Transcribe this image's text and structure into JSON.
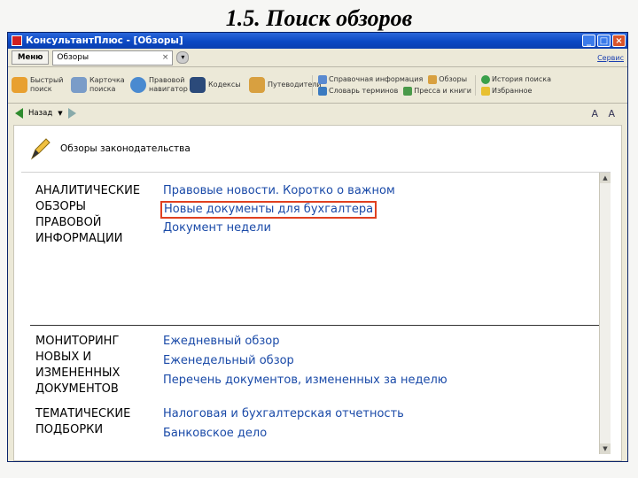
{
  "slide_title": "1.5. Поиск обзоров",
  "window": {
    "title": "КонсультантПлюс - [Обзоры]",
    "buttons": [
      "_",
      "□",
      "×"
    ]
  },
  "tabrow": {
    "menu_label": "Меню",
    "tab_label": "Обзоры",
    "right_link": "Сервис"
  },
  "toolbar": {
    "items": [
      {
        "label": "Быстрый поиск",
        "icon": "quick-search-icon"
      },
      {
        "label": "Карточка поиска",
        "icon": "search-card-icon"
      },
      {
        "label": "Правовой навигатор",
        "icon": "navigator-icon"
      },
      {
        "label": "Кодексы",
        "icon": "codes-icon"
      },
      {
        "label": "Путеводители",
        "icon": "guides-icon"
      }
    ],
    "group1": [
      "Справочная информация",
      "Обзоры",
      "Словарь терминов",
      "Пресса и книги"
    ],
    "group2": [
      "История поиска",
      "Избранное"
    ]
  },
  "navbar": {
    "back_label": "Назад",
    "font_control": "A A"
  },
  "content": {
    "header_title": "Обзоры законодательства",
    "sections": [
      {
        "title_lines": [
          "АНАЛИТИЧЕСКИЕ",
          "ОБЗОРЫ",
          "ПРАВОВОЙ",
          "ИНФОРМАЦИИ"
        ],
        "links": [
          "Правовые новости. Коротко о важном",
          "Новые документы для бухгалтера",
          "Документ недели"
        ]
      },
      {
        "title_lines": [
          "МОНИТОРИНГ",
          "НОВЫХ И",
          "ИЗМЕНЕННЫХ",
          "ДОКУМЕНТОВ"
        ],
        "links": [
          "Ежедневный обзор",
          "Еженедельный обзор",
          "Перечень документов, измененных за неделю"
        ]
      },
      {
        "title_lines": [
          "ТЕМАТИЧЕСКИЕ",
          "ПОДБОРКИ"
        ],
        "links": [
          "Налоговая и бухгалтерская отчетность",
          "Банковское дело"
        ]
      }
    ]
  },
  "colors": {
    "link": "#1a4aa8",
    "highlight": "#e04020",
    "titlebar": "#0b49c4"
  }
}
